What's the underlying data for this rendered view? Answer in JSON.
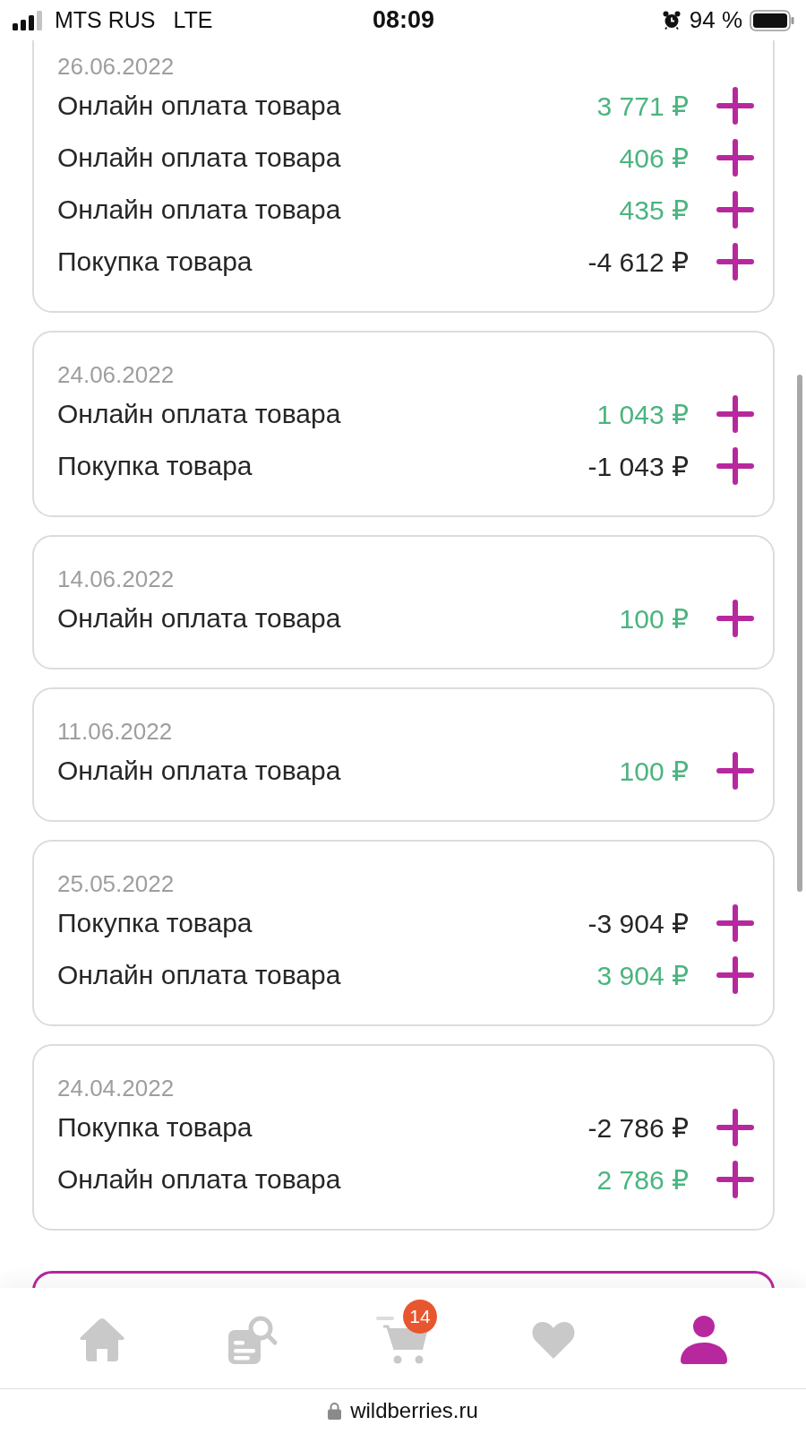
{
  "status_bar": {
    "carrier": "MTS RUS",
    "network": "LTE",
    "time": "08:09",
    "battery": "94 %"
  },
  "transactions": [
    {
      "date": "26.06.2022",
      "items": [
        {
          "label": "Онлайн оплата товара",
          "amount": "3 771 ₽",
          "color": "#4bb47f"
        },
        {
          "label": "Онлайн оплата товара",
          "amount": "406 ₽",
          "color": "#4bb47f"
        },
        {
          "label": "Онлайн оплата товара",
          "amount": "435 ₽",
          "color": "#4bb47f"
        },
        {
          "label": "Покупка товара",
          "amount": "-4 612 ₽",
          "color": "#262626"
        }
      ]
    },
    {
      "date": "24.06.2022",
      "items": [
        {
          "label": "Онлайн оплата товара",
          "amount": "1 043 ₽",
          "color": "#4bb47f"
        },
        {
          "label": "Покупка товара",
          "amount": "-1 043 ₽",
          "color": "#262626"
        }
      ]
    },
    {
      "date": "14.06.2022",
      "items": [
        {
          "label": "Онлайн оплата товара",
          "amount": "100 ₽",
          "color": "#4bb47f"
        }
      ]
    },
    {
      "date": "11.06.2022",
      "items": [
        {
          "label": "Онлайн оплата товара",
          "amount": "100 ₽",
          "color": "#4bb47f"
        }
      ]
    },
    {
      "date": "25.05.2022",
      "items": [
        {
          "label": "Покупка товара",
          "amount": "-3 904 ₽",
          "color": "#262626"
        },
        {
          "label": "Онлайн оплата товара",
          "amount": "3 904 ₽",
          "color": "#4bb47f"
        }
      ]
    },
    {
      "date": "24.04.2022",
      "items": [
        {
          "label": "Покупка товара",
          "amount": "-2 786 ₽",
          "color": "#262626"
        },
        {
          "label": "Онлайн оплата товара",
          "amount": "2 786 ₽",
          "color": "#4bb47f"
        }
      ]
    }
  ],
  "next_card": {
    "highlighted": true
  },
  "bottom_nav": [
    {
      "kind": "home",
      "selected": false
    },
    {
      "kind": "catalog",
      "selected": false
    },
    {
      "kind": "cart",
      "selected": false,
      "badge": "14"
    },
    {
      "kind": "favorites",
      "selected": false
    },
    {
      "kind": "profile",
      "selected": true
    }
  ],
  "url_bar": {
    "address": "wildberries.ru"
  }
}
